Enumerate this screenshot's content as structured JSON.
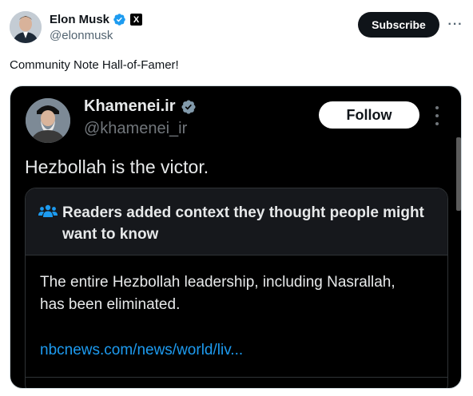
{
  "author": {
    "name": "Elon Musk",
    "handle": "@elonmusk",
    "affiliate_badge": "X"
  },
  "actions": {
    "subscribe_label": "Subscribe",
    "more_label": "···"
  },
  "tweet": {
    "text": "Community Note Hall-of-Famer!"
  },
  "embedded": {
    "name": "Khamenei.ir",
    "handle": "@khamenei_ir",
    "follow_label": "Follow",
    "text": "Hezbollah is the victor.",
    "community_note": {
      "title": "Readers added context they thought people might want to know",
      "body": "The entire Hezbollah leadership, including Nasrallah, has been eliminated.",
      "link": "nbcnews.com/news/world/liv..."
    }
  },
  "colors": {
    "verified_blue": "#1d9bf0",
    "dark_bg": "#000000",
    "note_header_bg": "#16181c",
    "link_blue": "#1d9bf0"
  }
}
